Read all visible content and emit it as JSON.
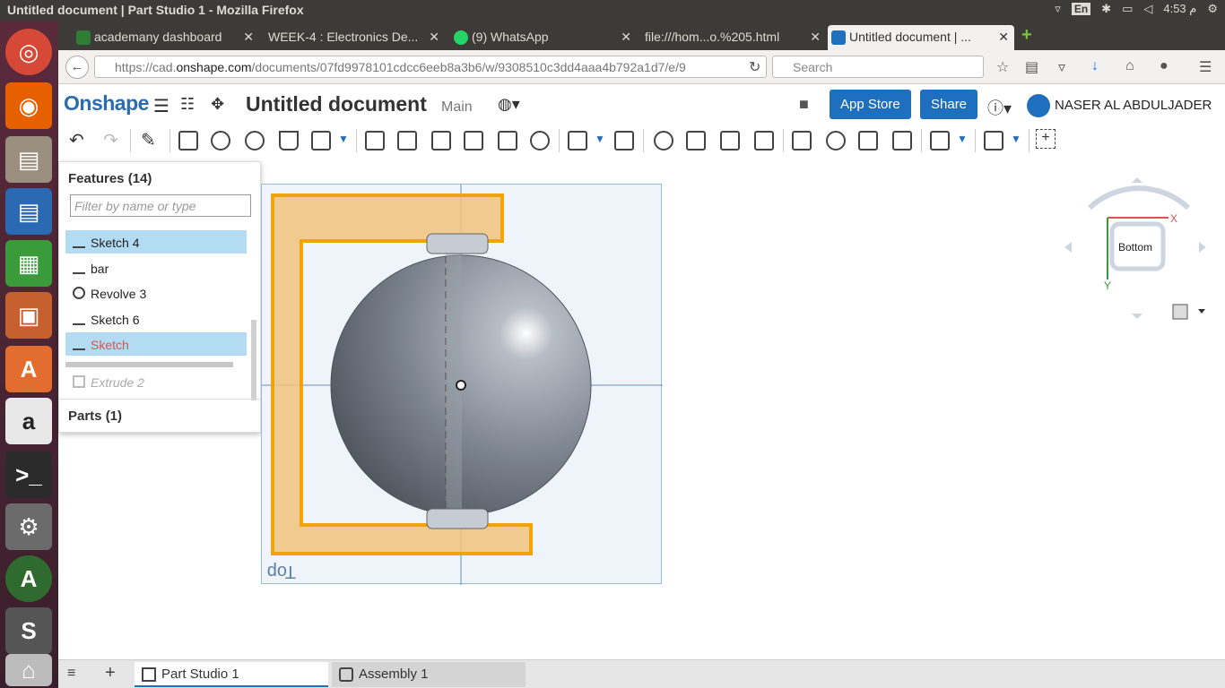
{
  "window": {
    "title": "Untitled document | Part Studio 1 - Mozilla Firefox",
    "time": "4:53 م",
    "keyboard": "En"
  },
  "tabs": [
    {
      "label": "academany dashboard"
    },
    {
      "label": "WEEK-4 : Electronics De..."
    },
    {
      "label": "(9) WhatsApp"
    },
    {
      "label": "file:///hom...o.%205.html"
    },
    {
      "label": "Untitled document | ..."
    }
  ],
  "nav": {
    "url_prefix": "https://cad.",
    "url_domain": "onshape.com",
    "url_path": "/documents/07fd9978101cdcc6eeb8a3b6/w/9308510c3dd4aaa4b792a1d7/e/9",
    "search_placeholder": "Search"
  },
  "onshape": {
    "logo": "Onshape",
    "document_title": "Untitled document",
    "workspace": "Main",
    "app_store": "App Store",
    "share": "Share",
    "user": "NASER AL ABDULJADER"
  },
  "features": {
    "header": "Features (14)",
    "filter_placeholder": "Filter by name or type",
    "items": [
      {
        "label": "Sketch 4",
        "icon": "sketch-icon",
        "selected": true
      },
      {
        "label": "bar",
        "icon": "sketch-icon",
        "selected": false
      },
      {
        "label": "Revolve 3",
        "icon": "revolve-icon",
        "selected": false
      },
      {
        "label": "Sketch 6",
        "icon": "sketch-icon",
        "selected": false
      },
      {
        "label": "Sketch",
        "icon": "sketch-icon",
        "selected": true,
        "highlight_color": "#d9534f"
      },
      {
        "label": "Extrude 2",
        "icon": "extrude-icon",
        "suppressed": true
      }
    ],
    "parts": "Parts (1)"
  },
  "viewport": {
    "plane_label": "Top",
    "sketch_color": "#f0a30a"
  },
  "viewcube": {
    "face": "Bottom",
    "x_axis": "X",
    "y_axis": "Y"
  },
  "bottom_tabs": [
    {
      "label": "Part Studio 1",
      "active": true
    },
    {
      "label": "Assembly 1",
      "active": false
    }
  ]
}
